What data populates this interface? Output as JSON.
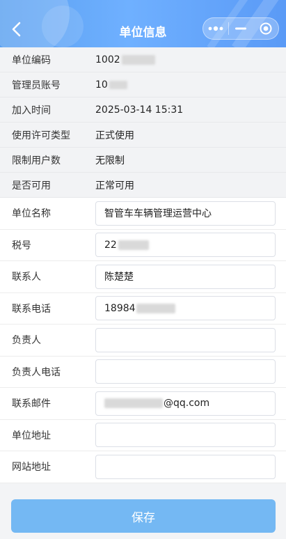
{
  "header": {
    "title": "单位信息",
    "back_icon": "chevron-left-icon",
    "menu_icon": "more-dots-icon",
    "minimize_icon": "minimize-icon",
    "close_icon": "target-close-icon"
  },
  "info_rows": [
    {
      "label": "单位编码",
      "value": "1002"
    },
    {
      "label": "管理员账号",
      "value": "10"
    },
    {
      "label": "加入时间",
      "value": "2025-03-14 15:31"
    },
    {
      "label": "使用许可类型",
      "value": "正式使用"
    },
    {
      "label": "限制用户数",
      "value": "无限制"
    },
    {
      "label": "是否可用",
      "value": "正常可用"
    }
  ],
  "form": [
    {
      "label": "单位名称",
      "value": "智管车车辆管理运营中心"
    },
    {
      "label": "税号",
      "value": "22"
    },
    {
      "label": "联系人",
      "value": "陈楚楚"
    },
    {
      "label": "联系电话",
      "value": "18984"
    },
    {
      "label": "负责人",
      "value": ""
    },
    {
      "label": "负责人电话",
      "value": ""
    },
    {
      "label": "联系邮件",
      "value": "@qq.com"
    },
    {
      "label": "单位地址",
      "value": ""
    },
    {
      "label": "网站地址",
      "value": ""
    }
  ],
  "footer": {
    "save_label": "保存"
  },
  "colors": {
    "header_accent": "#5aa0f0",
    "save_button": "#74b8f3"
  }
}
